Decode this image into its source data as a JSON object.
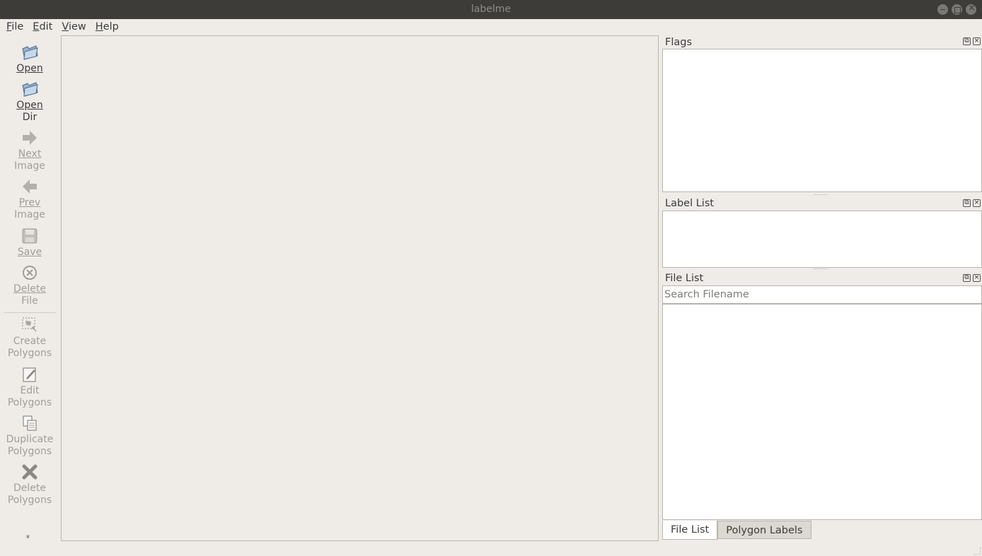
{
  "window": {
    "title": "labelme"
  },
  "menu": [
    {
      "label": "File",
      "mnemonic": "F",
      "rest": "ile"
    },
    {
      "label": "Edit",
      "mnemonic": "E",
      "rest": "dit"
    },
    {
      "label": "View",
      "mnemonic": "V",
      "rest": "iew"
    },
    {
      "label": "Help",
      "mnemonic": "H",
      "rest": "elp"
    }
  ],
  "toolbar": {
    "open": {
      "line1": "Open",
      "icon": "folder-open-icon"
    },
    "open_dir": {
      "line1": "Open",
      "line2": "Dir",
      "icon": "folder-open-icon"
    },
    "next_image": {
      "line1": "Next",
      "line2": "Image",
      "icon": "arrow-right-icon"
    },
    "prev_image": {
      "line1": "Prev",
      "line2": "Image",
      "icon": "arrow-left-icon"
    },
    "save": {
      "line1": "Save",
      "icon": "save-icon"
    },
    "delete_file": {
      "line1": "Delete",
      "line2": "File",
      "icon": "delete-circle-icon"
    },
    "create_polygons": {
      "line1": "Create",
      "line2": "Polygons",
      "icon": "create-polygon-icon"
    },
    "edit_polygons": {
      "line1": "Edit",
      "line2": "Polygons",
      "icon": "edit-icon"
    },
    "duplicate_polygons": {
      "line1": "Duplicate",
      "line2": "Polygons",
      "icon": "copy-icon"
    },
    "delete_polygons": {
      "line1": "Delete",
      "line2": "Polygons",
      "icon": "x-icon"
    },
    "more": "»"
  },
  "docks": {
    "flags": {
      "title": "Flags"
    },
    "label_list": {
      "title": "Label List"
    },
    "file_list": {
      "title": "File List",
      "search_placeholder": "Search Filename"
    }
  },
  "tabs": [
    {
      "label": "File List",
      "active": true
    },
    {
      "label": "Polygon Labels",
      "active": false
    }
  ],
  "colors": {
    "titlebar": "#3d3c38",
    "background": "#efebe7",
    "disabled_text": "#a19e99"
  }
}
